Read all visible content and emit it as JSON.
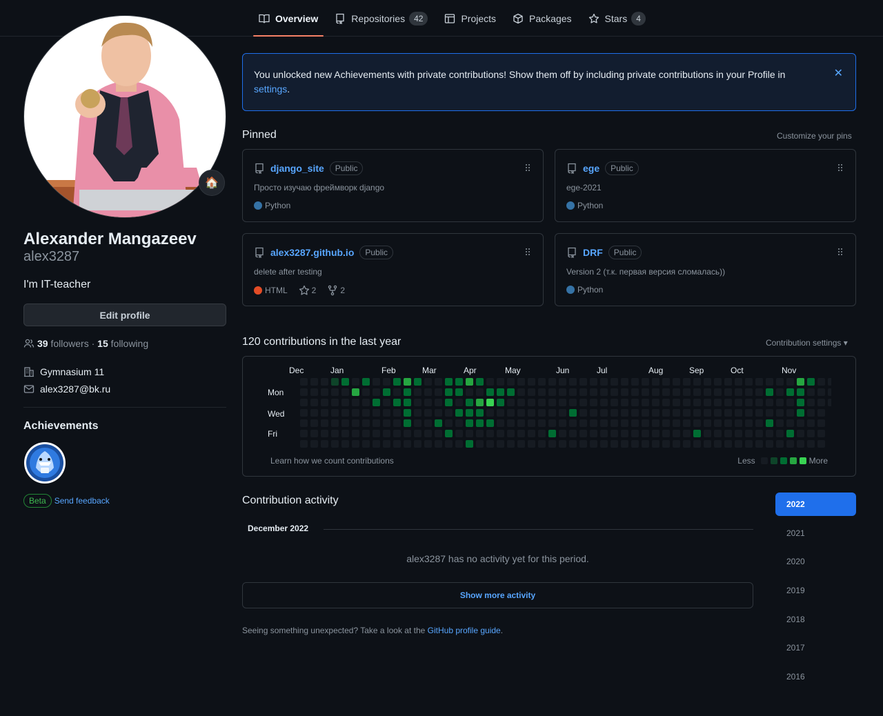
{
  "nav": {
    "tabs": [
      {
        "label": "Overview",
        "count": ""
      },
      {
        "label": "Repositories",
        "count": "42"
      },
      {
        "label": "Projects",
        "count": ""
      },
      {
        "label": "Packages",
        "count": ""
      },
      {
        "label": "Stars",
        "count": "4"
      }
    ]
  },
  "profile": {
    "full_name": "Alexander Mangazeev",
    "username": "alex3287",
    "bio": "I'm IT-teacher",
    "edit_label": "Edit profile",
    "followers_count": "39",
    "followers_label": "followers",
    "separator": "·",
    "following_count": "15",
    "following_label": "following",
    "organization": "Gymnasium 11",
    "email": "alex3287@bk.ru",
    "status_emoji": "🏠",
    "achievements_title": "Achievements",
    "beta_label": "Beta",
    "feedback_label": "Send feedback"
  },
  "banner": {
    "text": "You unlocked new Achievements with private contributions! Show them off by including private contributions in your Profile in ",
    "link": "settings",
    "end": ".",
    "close": "✕"
  },
  "pinned": {
    "title": "Pinned",
    "customize": "Customize your pins",
    "items": [
      {
        "name": "django_site",
        "visibility": "Public",
        "description": "Просто изучаю фреймворк django",
        "language": "Python",
        "lang_color": "#3572A5",
        "stars": "",
        "forks": ""
      },
      {
        "name": "ege",
        "visibility": "Public",
        "description": "ege-2021",
        "language": "Python",
        "lang_color": "#3572A5",
        "stars": "",
        "forks": ""
      },
      {
        "name": "alex3287.github.io",
        "visibility": "Public",
        "description": "delete after testing",
        "language": "HTML",
        "lang_color": "#e34c26",
        "stars": "2",
        "forks": "2"
      },
      {
        "name": "DRF",
        "visibility": "Public",
        "description": "Version 2 (т.к. первая версия сломалась))",
        "language": "Python",
        "lang_color": "#3572A5",
        "stars": "",
        "forks": ""
      }
    ]
  },
  "contributions": {
    "title": "120 contributions in the last year",
    "settings": "Contribution settings ▾",
    "months": [
      "Dec",
      "Jan",
      "Feb",
      "Mar",
      "Apr",
      "May",
      "Jun",
      "Jul",
      "Aug",
      "Sep",
      "Oct",
      "Nov"
    ],
    "days": [
      "Mon",
      "Wed",
      "Fri"
    ],
    "learn": "Learn how we count contributions",
    "less": "Less",
    "more": "More",
    "colors": [
      "#161b22",
      "#0e4429",
      "#006d32",
      "#26a641",
      "#39d353"
    ],
    "cells": [
      [
        3,
        0,
        1
      ],
      [
        4,
        0,
        2
      ],
      [
        5,
        1,
        3
      ],
      [
        6,
        0,
        2
      ],
      [
        7,
        2,
        2
      ],
      [
        8,
        1,
        2
      ],
      [
        9,
        0,
        2
      ],
      [
        9,
        2,
        2
      ],
      [
        10,
        0,
        3
      ],
      [
        10,
        1,
        2
      ],
      [
        10,
        2,
        2
      ],
      [
        10,
        3,
        2
      ],
      [
        10,
        4,
        2
      ],
      [
        11,
        0,
        2
      ],
      [
        13,
        4,
        2
      ],
      [
        14,
        0,
        2
      ],
      [
        14,
        1,
        2
      ],
      [
        14,
        2,
        2
      ],
      [
        14,
        5,
        2
      ],
      [
        15,
        0,
        2
      ],
      [
        15,
        1,
        2
      ],
      [
        15,
        3,
        2
      ],
      [
        16,
        0,
        3
      ],
      [
        16,
        2,
        2
      ],
      [
        16,
        3,
        2
      ],
      [
        16,
        4,
        2
      ],
      [
        16,
        6,
        2
      ],
      [
        17,
        0,
        2
      ],
      [
        17,
        2,
        3
      ],
      [
        17,
        3,
        2
      ],
      [
        17,
        4,
        2
      ],
      [
        18,
        1,
        2
      ],
      [
        18,
        2,
        4
      ],
      [
        18,
        4,
        2
      ],
      [
        19,
        1,
        2
      ],
      [
        19,
        2,
        2
      ],
      [
        20,
        1,
        2
      ],
      [
        24,
        5,
        2
      ],
      [
        26,
        3,
        2
      ],
      [
        38,
        5,
        2
      ],
      [
        45,
        1,
        2
      ],
      [
        45,
        4,
        2
      ],
      [
        47,
        1,
        2
      ],
      [
        47,
        5,
        2
      ],
      [
        48,
        0,
        3
      ],
      [
        48,
        1,
        2
      ],
      [
        48,
        2,
        2
      ],
      [
        48,
        3,
        2
      ],
      [
        49,
        0,
        2
      ]
    ]
  },
  "activity": {
    "title": "Contribution activity",
    "month": "December 2022",
    "empty": "alex3287 has no activity yet for this period.",
    "show_more": "Show more activity",
    "guide_text": "Seeing something unexpected? Take a look at the ",
    "guide_link": "GitHub profile guide",
    "guide_end": ".",
    "years": [
      "2022",
      "2021",
      "2020",
      "2019",
      "2018",
      "2017",
      "2016"
    ]
  }
}
